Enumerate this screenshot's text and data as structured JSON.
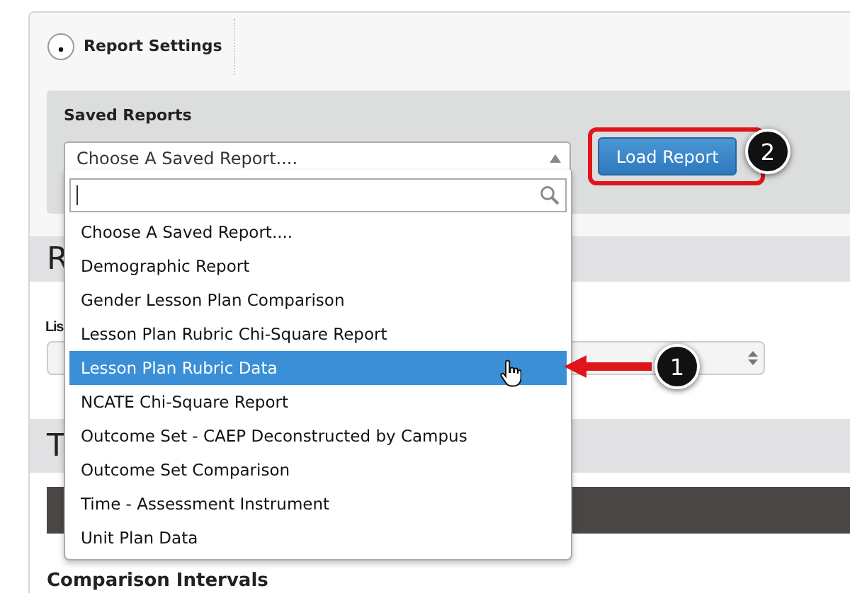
{
  "tab": {
    "label": "Report Settings"
  },
  "saved_reports": {
    "label": "Saved Reports",
    "select": {
      "value": "Choose A Saved Report....",
      "expanded": true
    },
    "options": [
      {
        "label": "Choose A Saved Report....",
        "selected": false
      },
      {
        "label": "Demographic Report",
        "selected": false
      },
      {
        "label": "Gender Lesson Plan Comparison",
        "selected": false
      },
      {
        "label": "Lesson Plan Rubric Chi-Square Report",
        "selected": false
      },
      {
        "label": "Lesson Plan Rubric Data",
        "selected": true
      },
      {
        "label": "NCATE Chi-Square Report",
        "selected": false
      },
      {
        "label": "Outcome Set - CAEP Deconstructed by Campus",
        "selected": false
      },
      {
        "label": "Outcome Set Comparison",
        "selected": false
      },
      {
        "label": "Time - Assessment Instrument",
        "selected": false
      },
      {
        "label": "Unit Plan Data",
        "selected": false
      }
    ],
    "load_button": "Load Report"
  },
  "section_1": {
    "title": "R",
    "list_label": "Lis"
  },
  "section_2": {
    "title": "T"
  },
  "comparison": {
    "heading": "Comparison Intervals"
  },
  "callouts": [
    {
      "number": "1"
    },
    {
      "number": "2"
    }
  ]
}
